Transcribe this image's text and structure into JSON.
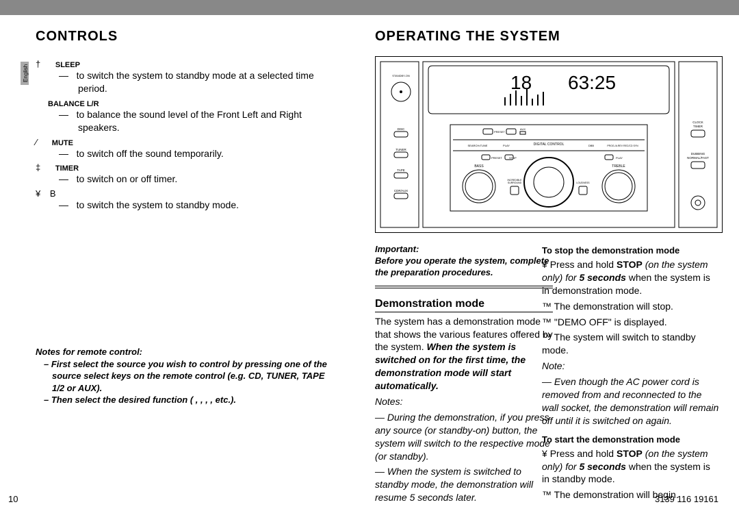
{
  "side_tab": "English",
  "headers": {
    "left": "CONTROLS",
    "right": "OPERATING THE SYSTEM"
  },
  "controls": {
    "items": [
      {
        "sym": "†",
        "label": "SLEEP",
        "desc": "to switch the system to standby mode at a selected time period."
      },
      {
        "sym": "",
        "label": "BALANCE L/R",
        "desc": "to balance the sound level of the Front Left and Right speakers."
      },
      {
        "sym": "⁄",
        "label": "MUTE",
        "desc": "to switch off the sound temporarily."
      },
      {
        "sym": "‡",
        "label": "TIMER",
        "desc": "to switch on or off timer."
      },
      {
        "sym": "¥",
        "label": "B",
        "desc": "to switch the system to standby mode."
      }
    ]
  },
  "remote_notes": {
    "title": "Notes for remote control:",
    "items": [
      "First select the source you wish to control by pressing one of the source select keys on the remote control (e.g. CD, TUNER, TAPE 1/2 or AUX).",
      "Then select the desired function (   ,   ,   ,   , etc.)."
    ]
  },
  "important": {
    "label": "Important:",
    "text": "Before you operate the system, complete the preparation procedures."
  },
  "demo": {
    "title": "Demonstration mode",
    "intro_a": "The system has a demonstration mode that shows the various features offered by the system. ",
    "intro_b": "When the system is switched on for the first time, the demonstration mode will start automatically.",
    "notes_label": "Notes:",
    "notes": [
      "During the demonstration, if you press any source (or standby-on) button, the system will switch to the respective mode (or standby).",
      "When the system is switched to standby mode, the demonstration will resume 5 seconds later."
    ]
  },
  "stop": {
    "title": "To stop the demonstration mode",
    "bullet_sym": "¥",
    "line_a": "Press and hold ",
    "line_b": "STOP",
    "line_c": " (on the system only) for ",
    "line_d": "5 seconds",
    "line_e": " when the system is in demonstration mode.",
    "results": [
      "The demonstration will stop.",
      "\"DEMO OFF\" is displayed.",
      "The system will switch to standby mode."
    ],
    "note_label": "Note:",
    "note": "Even though the AC power cord is removed from and reconnected to the wall socket, the demonstration will remain off until it is switched on again."
  },
  "start": {
    "title": "To start the demonstration mode",
    "bullet_sym": "¥",
    "line_a": "Press and hold ",
    "line_b": "STOP",
    "line_c": " (on the system only) for ",
    "line_d": "5 seconds",
    "line_e": " when the system is in standby mode.",
    "result": "The demonstration will begin."
  },
  "page": {
    "left": "10",
    "right": "3139 116 19161"
  },
  "diagram": {
    "standby": "STANDBY-ON",
    "disc": "DISC",
    "tuner": "TUNER",
    "tape": "TAPE",
    "cdraux": "CDR/AUX",
    "bass": "BASS",
    "treble": "TREBLE",
    "incsur": "INCREDIBLE\nSURROUND",
    "loud": "LOUDNESS",
    "digital": "DIGITAL CONTROL",
    "preset_minus": "PRESET",
    "aux": "AUX",
    "search_tune": "SEARCH•TUNE",
    "play": "PLAY",
    "stop": "STOP",
    "dbb": "DBB",
    "prog": "PROG./A.REV  REC/CD SYN",
    "display_track": "18",
    "display_time": "63:25",
    "clock": "CLOCK",
    "timer": "TIMER",
    "dubbing": "DUBBING",
    "normalfast": "NORMAL/FAST"
  }
}
